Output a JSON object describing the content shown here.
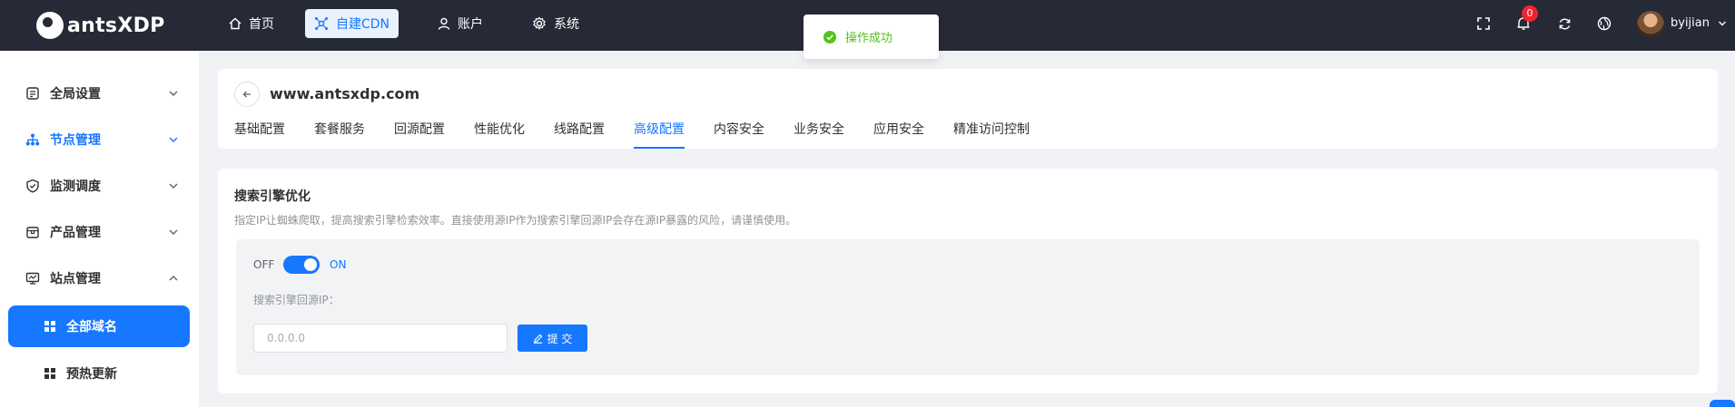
{
  "app": {
    "logo_text": "antsXDP"
  },
  "topnav": {
    "items": [
      {
        "label": "首页",
        "icon": "home-icon"
      },
      {
        "label": "自建CDN",
        "icon": "cdn-network-icon",
        "active": true
      },
      {
        "label": "账户",
        "icon": "user-icon"
      },
      {
        "label": "系统",
        "icon": "gear-icon"
      }
    ]
  },
  "toolbar": {
    "notification_count": "0",
    "username": "byijian",
    "icons": [
      "fullscreen-icon",
      "bell-icon",
      "refresh-icon",
      "globe-icon"
    ]
  },
  "toast": {
    "message": "操作成功",
    "type": "success"
  },
  "sidebar": {
    "items": [
      {
        "label": "全局设置",
        "icon": "settings-doc-icon",
        "expanded": false
      },
      {
        "label": "节点管理",
        "icon": "node-tree-icon",
        "expanded": false,
        "highlighted": true
      },
      {
        "label": "监测调度",
        "icon": "shield-check-icon",
        "expanded": false
      },
      {
        "label": "产品管理",
        "icon": "box-icon",
        "expanded": false
      },
      {
        "label": "站点管理",
        "icon": "monitor-icon",
        "expanded": true
      }
    ],
    "sub_items": [
      {
        "label": "全部域名",
        "active": true
      },
      {
        "label": "预热更新",
        "active": false
      }
    ]
  },
  "header": {
    "domain": "www.antsxdp.com",
    "tabs": [
      {
        "label": "基础配置"
      },
      {
        "label": "套餐服务"
      },
      {
        "label": "回源配置"
      },
      {
        "label": "性能优化"
      },
      {
        "label": "线路配置"
      },
      {
        "label": "高级配置",
        "active": true
      },
      {
        "label": "内容安全"
      },
      {
        "label": "业务安全"
      },
      {
        "label": "应用安全"
      },
      {
        "label": "精准访问控制"
      }
    ]
  },
  "seo": {
    "title": "搜索引擎优化",
    "description": "指定IP让蜘蛛爬取，提高搜索引擎检索效率。直接使用源IP作为搜索引擎回源IP会存在源IP暴露的风险，请谨慎使用。",
    "switch_off_label": "OFF",
    "switch_on_label": "ON",
    "switch_state": "on",
    "ip_label": "搜索引擎回源IP：",
    "ip_placeholder": "0.0.0.0",
    "ip_value": "",
    "submit_label": "提 交"
  },
  "colors": {
    "primary": "#1677ff",
    "topbar_bg": "#262a36",
    "success": "#52c41a",
    "badge": "#f5222d"
  }
}
